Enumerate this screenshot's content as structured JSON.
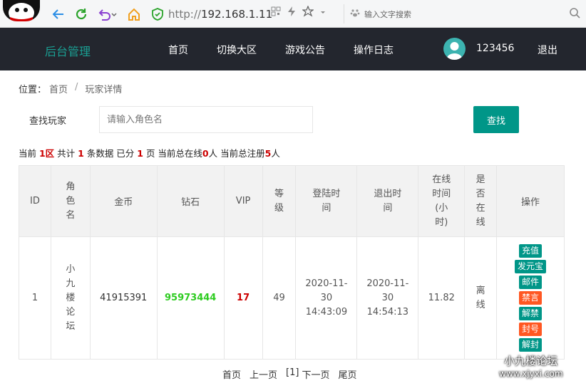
{
  "browser": {
    "url_protocol": "http://",
    "url_host": "192.168.1.11",
    "search_placeholder": "输入文字搜索"
  },
  "header": {
    "brand": "后台管理",
    "nav": [
      "首页",
      "切换大区",
      "游戏公告",
      "操作日志"
    ],
    "username": "123456",
    "logout": "退出"
  },
  "breadcrumb": {
    "label": "位置：",
    "home": "首页",
    "separator": "/",
    "current": "玩家详情"
  },
  "search": {
    "label": "查找玩家",
    "placeholder": "请输入角色名",
    "button": "查找"
  },
  "summary": {
    "t1": "当前 ",
    "zone": "1区",
    "t2": " 共计 ",
    "count": "1",
    "t3": " 条数据 已分 ",
    "pages": "1",
    "t4": " 页 当前总在线",
    "online": "0",
    "t5": "人 当前总注册",
    "registered": "5",
    "t6": "人"
  },
  "table": {
    "headers": [
      "ID",
      "角\n色\n名",
      "金币",
      "钻石",
      "VIP",
      "等\n级",
      "登陆时\n间",
      "退出时\n间",
      "在线\n时间\n(小\n时)",
      "是\n否\n在\n线",
      "操作"
    ],
    "row": {
      "id": "1",
      "name": "小\n九\n楼\n论\n坛",
      "gold": "41915391",
      "diamond": "95973444",
      "vip": "17",
      "level": "49",
      "login": "2020-11-\n30\n14:43:09",
      "logout": "2020-11-\n30\n14:54:13",
      "hours": "11.82",
      "online": "离\n线"
    },
    "ops": [
      "充值",
      "发元宝",
      "邮件",
      "禁言",
      "解禁",
      "封号",
      "解封"
    ]
  },
  "pagination": {
    "first": "首页",
    "prev": "上一页",
    "current": "[1]",
    "next": "下一页",
    "last": "尾页"
  },
  "watermark": {
    "name": "小九楼论坛",
    "url": "www.xjyxi.com"
  },
  "colors": {
    "accent": "#009688",
    "header_bg": "#23262e",
    "danger": "#ff5722"
  }
}
